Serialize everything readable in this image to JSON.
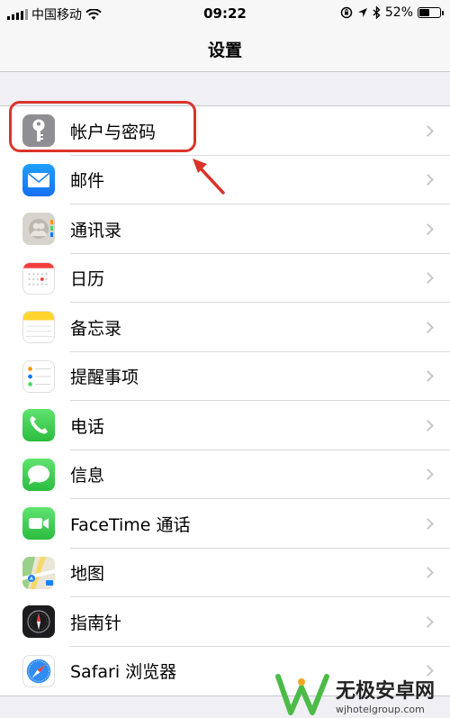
{
  "status_bar": {
    "carrier": "中国移动",
    "time": "09:22",
    "battery": "52%",
    "battery_level": 0.52,
    "icons": [
      "signal-icon",
      "wifi-icon",
      "orientation-lock-icon",
      "location-icon",
      "bluetooth-icon",
      "battery-icon"
    ]
  },
  "nav": {
    "title": "设置"
  },
  "settings_items": [
    {
      "label": "帐户与密码",
      "icon": "key-icon",
      "color": "#8e8e93"
    },
    {
      "label": "邮件",
      "icon": "mail-icon",
      "color": "#1a82fb"
    },
    {
      "label": "通讯录",
      "icon": "contacts-icon",
      "color": "#c7c4bd"
    },
    {
      "label": "日历",
      "icon": "calendar-icon",
      "color": "#ffffff"
    },
    {
      "label": "备忘录",
      "icon": "notes-icon",
      "color": "#ffd52e"
    },
    {
      "label": "提醒事项",
      "icon": "reminders-icon",
      "color": "#ffffff"
    },
    {
      "label": "电话",
      "icon": "phone-icon",
      "color": "#34c759"
    },
    {
      "label": "信息",
      "icon": "messages-icon",
      "color": "#34c759"
    },
    {
      "label": "FaceTime 通话",
      "icon": "facetime-icon",
      "color": "#34c759"
    },
    {
      "label": "地图",
      "icon": "maps-icon",
      "color": "#7ec66f"
    },
    {
      "label": "指南针",
      "icon": "compass-icon",
      "color": "#1c1c1e"
    },
    {
      "label": "Safari 浏览器",
      "icon": "safari-icon",
      "color": "#ffffff"
    }
  ],
  "watermark": {
    "title": "无极安卓网",
    "url": "wjhotelgroup.com"
  },
  "annotation_color": "#d9342b"
}
